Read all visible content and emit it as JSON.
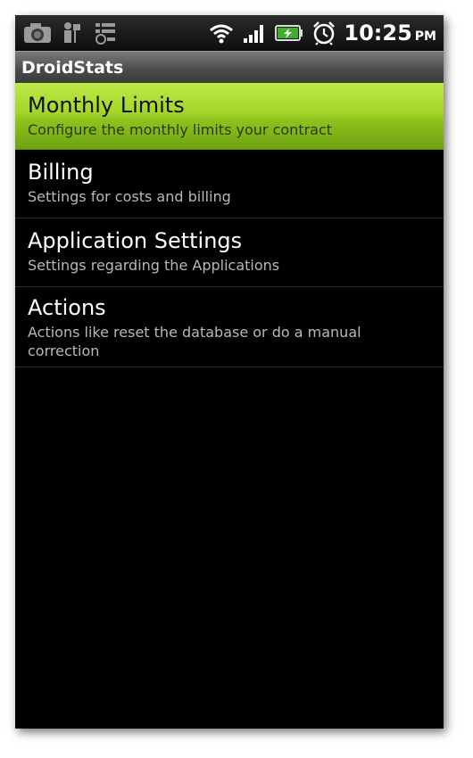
{
  "status_bar": {
    "time": "10:25",
    "ampm": "PM",
    "left_icons": [
      "camera-icon",
      "usb-debug-icon",
      "task-list-icon"
    ],
    "right_icons": [
      "wifi-icon",
      "signal-icon",
      "battery-charging-icon",
      "alarm-clock-icon"
    ]
  },
  "app": {
    "title": "DroidStats"
  },
  "menu": {
    "items": [
      {
        "title": "Monthly Limits",
        "summary": "Configure the monthly limits your contract",
        "selected": true
      },
      {
        "title": "Billing",
        "summary": "Settings for costs and billing",
        "selected": false
      },
      {
        "title": "Application Settings",
        "summary": "Settings regarding the Applications",
        "selected": false
      },
      {
        "title": "Actions",
        "summary": "Actions like reset the database or do a manual correction",
        "selected": false
      }
    ]
  },
  "colors": {
    "selected_highlight": "#a3d52a",
    "background": "#000000",
    "summary_text": "#b8b8b8"
  }
}
